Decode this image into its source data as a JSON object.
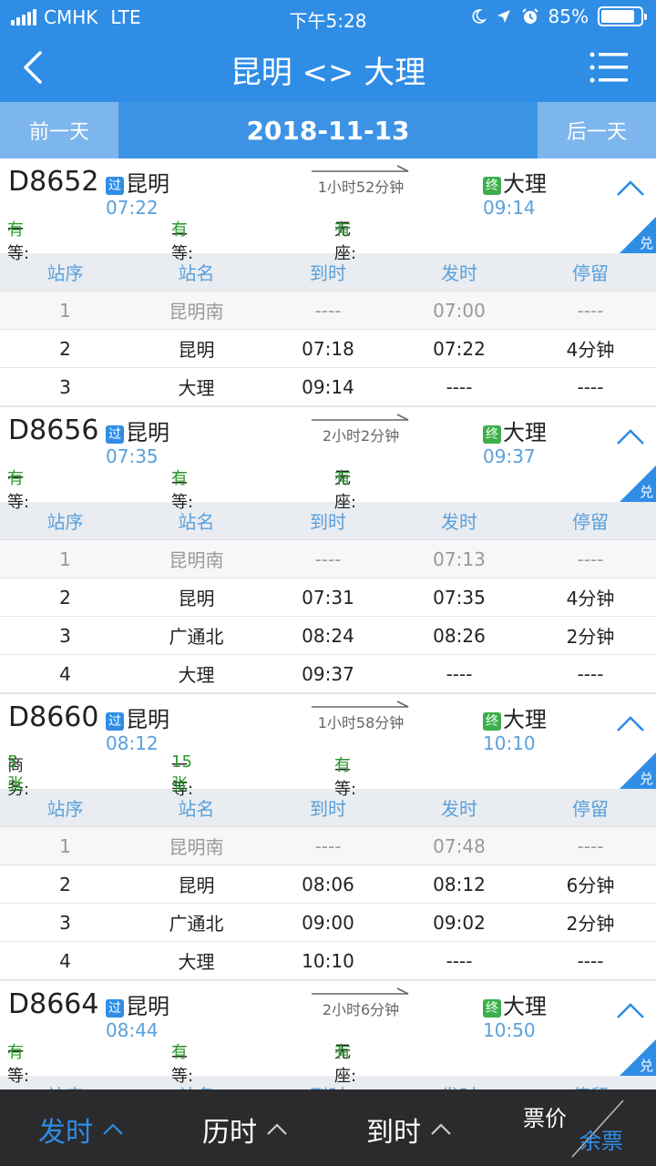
{
  "status": {
    "carrier": "CMHK",
    "network": "LTE",
    "time": "下午5:28",
    "battery": "85%",
    "battery_level": 0.85
  },
  "header": {
    "title": "昆明 <> 大理"
  },
  "datebar": {
    "prev": "前一天",
    "date": "2018-11-13",
    "next": "后一天"
  },
  "table_headers": [
    "站序",
    "站名",
    "到时",
    "发时",
    "停留"
  ],
  "trains": [
    {
      "no": "D8652",
      "from_tag": "过",
      "from": "昆明",
      "dep": "07:22",
      "duration": "1小时52分钟",
      "to_tag": "终",
      "to": "大理",
      "arr": "09:14",
      "seats": [
        {
          "label": "一等: ",
          "value": "有"
        },
        {
          "label": "二等: ",
          "value": "有"
        },
        {
          "label": "无座: ",
          "value": "有"
        }
      ],
      "badge": "兑",
      "stops": [
        [
          "1",
          "昆明南",
          "----",
          "07:00",
          "----"
        ],
        [
          "2",
          "昆明",
          "07:18",
          "07:22",
          "4分钟"
        ],
        [
          "3",
          "大理",
          "09:14",
          "----",
          "----"
        ]
      ]
    },
    {
      "no": "D8656",
      "from_tag": "过",
      "from": "昆明",
      "dep": "07:35",
      "duration": "2小时2分钟",
      "to_tag": "终",
      "to": "大理",
      "arr": "09:37",
      "seats": [
        {
          "label": "一等: ",
          "value": "有"
        },
        {
          "label": "二等: ",
          "value": "有"
        },
        {
          "label": "无座: ",
          "value": "有"
        }
      ],
      "badge": "兑",
      "stops": [
        [
          "1",
          "昆明南",
          "----",
          "07:13",
          "----"
        ],
        [
          "2",
          "昆明",
          "07:31",
          "07:35",
          "4分钟"
        ],
        [
          "3",
          "广通北",
          "08:24",
          "08:26",
          "2分钟"
        ],
        [
          "4",
          "大理",
          "09:37",
          "----",
          "----"
        ]
      ]
    },
    {
      "no": "D8660",
      "from_tag": "过",
      "from": "昆明",
      "dep": "08:12",
      "duration": "1小时58分钟",
      "to_tag": "终",
      "to": "大理",
      "arr": "10:10",
      "seats": [
        {
          "label": "商务: ",
          "value": "5张"
        },
        {
          "label": "一等: ",
          "value": "15张"
        },
        {
          "label": "二等: ",
          "value": "有"
        }
      ],
      "badge": "兑",
      "stops": [
        [
          "1",
          "昆明南",
          "----",
          "07:48",
          "----"
        ],
        [
          "2",
          "昆明",
          "08:06",
          "08:12",
          "6分钟"
        ],
        [
          "3",
          "广通北",
          "09:00",
          "09:02",
          "2分钟"
        ],
        [
          "4",
          "大理",
          "10:10",
          "----",
          "----"
        ]
      ]
    },
    {
      "no": "D8664",
      "from_tag": "过",
      "from": "昆明",
      "dep": "08:44",
      "duration": "2小时6分钟",
      "to_tag": "终",
      "to": "大理",
      "arr": "10:50",
      "seats": [
        {
          "label": "一等: ",
          "value": "有"
        },
        {
          "label": "二等: ",
          "value": "有"
        },
        {
          "label": "无座: ",
          "value": "有"
        }
      ],
      "badge": "兑",
      "stops": []
    }
  ],
  "bottom": {
    "sort_depart": "发时",
    "sort_duration": "历时",
    "sort_arrive": "到时",
    "price": "票价",
    "remaining": "余票"
  },
  "colors": {
    "primary": "#2f8de6",
    "available": "#2b9a2b",
    "terminal": "#3cae4b"
  }
}
